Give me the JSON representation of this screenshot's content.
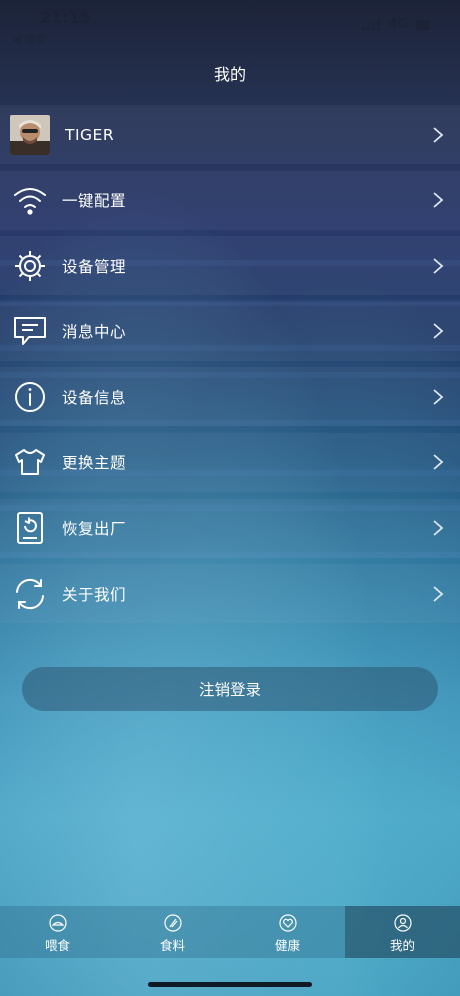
{
  "status_bar": {
    "time": "21:15",
    "back_label": "◀ 搜索",
    "network": "4G"
  },
  "nav": {
    "title": "我的"
  },
  "menu": [
    {
      "label": "TIGER",
      "icon": "avatar"
    },
    {
      "label": "一键配置",
      "icon": "wifi-icon"
    },
    {
      "label": "设备管理",
      "icon": "gear-icon"
    },
    {
      "label": "消息中心",
      "icon": "message-icon"
    },
    {
      "label": "设备信息",
      "icon": "info-icon"
    },
    {
      "label": "更换主题",
      "icon": "tshirt-icon"
    },
    {
      "label": "恢复出厂",
      "icon": "restore-icon"
    },
    {
      "label": "关于我们",
      "icon": "refresh-icon"
    }
  ],
  "logout": {
    "label": "注销登录"
  },
  "tabs": [
    {
      "label": "喂食",
      "icon": "feed-icon"
    },
    {
      "label": "食料",
      "icon": "food-icon"
    },
    {
      "label": "健康",
      "icon": "health-icon"
    },
    {
      "label": "我的",
      "icon": "profile-icon",
      "active": true
    }
  ]
}
